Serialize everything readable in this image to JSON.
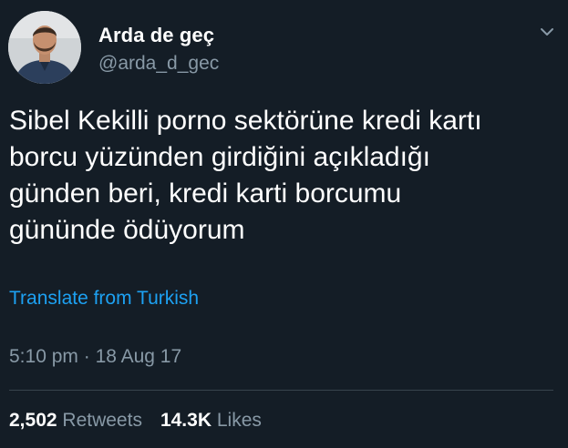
{
  "user": {
    "display_name": "Arda de geç",
    "handle": "@arda_d_gec",
    "avatar_icon": "user-avatar-photo"
  },
  "tweet": {
    "lines": [
      "Sibel Kekilli porno sektörüne kredi kartı",
      "borcu yüzünden girdiğini açıkladığı",
      "günden beri, kredi karti borcumu",
      "gününde ödüyorum"
    ],
    "translate_label": "Translate from Turkish",
    "time": "5:10 pm",
    "separator": "·",
    "date": "18 Aug 17"
  },
  "stats": {
    "retweets_count": "2,502",
    "retweets_label": "Retweets",
    "likes_count": "14.3K",
    "likes_label": "Likes"
  },
  "icons": {
    "menu": "chevron-down-icon"
  },
  "colors": {
    "background": "#141d26",
    "primary_text": "#ffffff",
    "secondary_text": "#8899a6",
    "link": "#1da1f2",
    "divider": "#38444d"
  }
}
